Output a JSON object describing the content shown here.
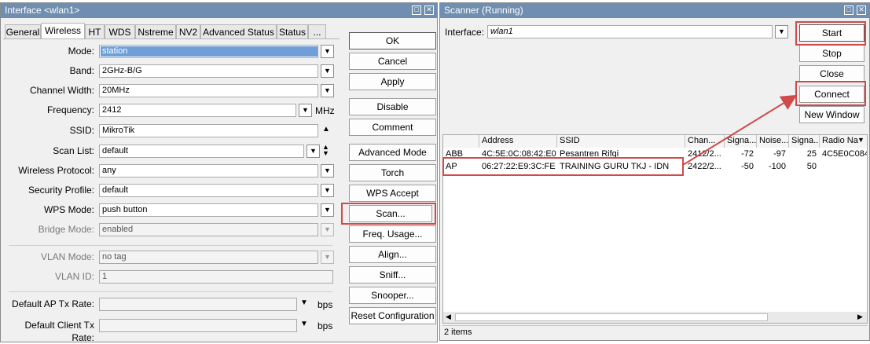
{
  "left_window": {
    "title": "Interface <wlan1>",
    "tabs": [
      "General",
      "Wireless",
      "HT",
      "WDS",
      "Nstreme",
      "NV2",
      "Advanced Status",
      "Status",
      "..."
    ],
    "active_tab": "Wireless",
    "fields": {
      "mode": {
        "label": "Mode:",
        "value": "station"
      },
      "band": {
        "label": "Band:",
        "value": "2GHz-B/G"
      },
      "channel_width": {
        "label": "Channel Width:",
        "value": "20MHz"
      },
      "frequency": {
        "label": "Frequency:",
        "value": "2412",
        "unit": "MHz"
      },
      "ssid": {
        "label": "SSID:",
        "value": "MikroTik"
      },
      "scan_list": {
        "label": "Scan List:",
        "value": "default"
      },
      "wireless_protocol": {
        "label": "Wireless Protocol:",
        "value": "any"
      },
      "security_profile": {
        "label": "Security Profile:",
        "value": "default"
      },
      "wps_mode": {
        "label": "WPS Mode:",
        "value": "push button"
      },
      "bridge_mode": {
        "label": "Bridge Mode:",
        "value": "enabled"
      },
      "vlan_mode": {
        "label": "VLAN Mode:",
        "value": "no tag"
      },
      "vlan_id": {
        "label": "VLAN ID:",
        "value": "1"
      },
      "default_ap_tx_rate": {
        "label": "Default AP Tx Rate:",
        "value": "",
        "unit": "bps"
      },
      "default_client_tx_rate": {
        "label": "Default Client Tx Rate:",
        "value": "",
        "unit": "bps"
      }
    },
    "buttons": {
      "ok": "OK",
      "cancel": "Cancel",
      "apply": "Apply",
      "disable": "Disable",
      "comment": "Comment",
      "advanced_mode": "Advanced Mode",
      "torch": "Torch",
      "wps_accept": "WPS Accept",
      "scan": "Scan...",
      "freq_usage": "Freq. Usage...",
      "align": "Align...",
      "sniff": "Sniff...",
      "snooper": "Snooper...",
      "reset_configuration": "Reset Configuration"
    }
  },
  "scanner_window": {
    "title": "Scanner (Running)",
    "interface_label": "Interface:",
    "interface_value": "wlan1",
    "buttons": {
      "start": "Start",
      "stop": "Stop",
      "close": "Close",
      "connect": "Connect",
      "new_window": "New Window"
    },
    "columns": [
      "",
      "Address",
      "SSID",
      "Chan...",
      "Signa...",
      "Noise...",
      "Signa...",
      "Radio Na"
    ],
    "rows": [
      {
        "flags": "ABB",
        "address": "4C:5E:0C:08:42:E0",
        "ssid": "Pesantren Rifqi",
        "channel": "2412/2...",
        "signal": "-72",
        "noise": "-97",
        "snr": "25",
        "radio_name": "4C5E0C084"
      },
      {
        "flags": "AP",
        "address": "06:27:22:E9:3C:FE",
        "ssid": "TRAINING GURU TKJ - IDN",
        "channel": "2422/2...",
        "signal": "-50",
        "noise": "-100",
        "snr": "50",
        "radio_name": ""
      }
    ],
    "status": "2 items"
  },
  "colors": {
    "titlebar": "#6f8eb0",
    "highlight": "#d04a4a",
    "selection": "#6f9fd6"
  }
}
